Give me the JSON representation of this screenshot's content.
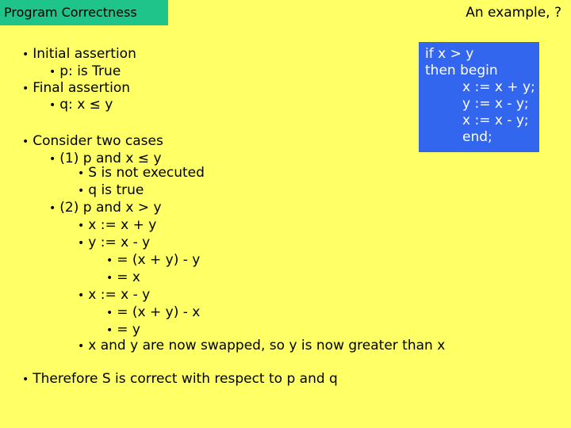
{
  "header": {
    "title": "Program Correctness",
    "subtitle": "An example, ?"
  },
  "colors": {
    "background": "#ffff66",
    "title_bar": "#1ec48a",
    "code_box": "#3366ee"
  },
  "code": {
    "lines": [
      "if x > y",
      "then begin",
      "x := x + y;",
      "y := x - y;",
      "x := x - y;",
      "end;"
    ]
  },
  "bullets": [
    {
      "level": 1,
      "text": "Initial assertion"
    },
    {
      "level": 2,
      "text": "p: is True"
    },
    {
      "level": 1,
      "text": "Final assertion"
    },
    {
      "level": 2,
      "text": "q:  x ≤  y"
    },
    {
      "level": 1,
      "text": "Consider two cases"
    },
    {
      "level": 2,
      "text": "(1) p and x ≤  y"
    },
    {
      "level": 3,
      "text": "S is not executed"
    },
    {
      "level": 3,
      "text": "q is true"
    },
    {
      "level": 2,
      "text": "(2) p and x > y"
    },
    {
      "level": 3,
      "text": "x := x + y"
    },
    {
      "level": 3,
      "text": "y := x - y"
    },
    {
      "level": 4,
      "text": "= (x + y) - y"
    },
    {
      "level": 4,
      "text": "= x"
    },
    {
      "level": 3,
      "text": "x := x - y"
    },
    {
      "level": 4,
      "text": "= (x + y) - x"
    },
    {
      "level": 4,
      "text": "= y"
    },
    {
      "level": 3,
      "text": "x and y are now swapped, so y is now greater than x"
    },
    {
      "level": 1,
      "text": "Therefore S is correct with respect to p and q"
    }
  ],
  "bullet_glyph": "•"
}
